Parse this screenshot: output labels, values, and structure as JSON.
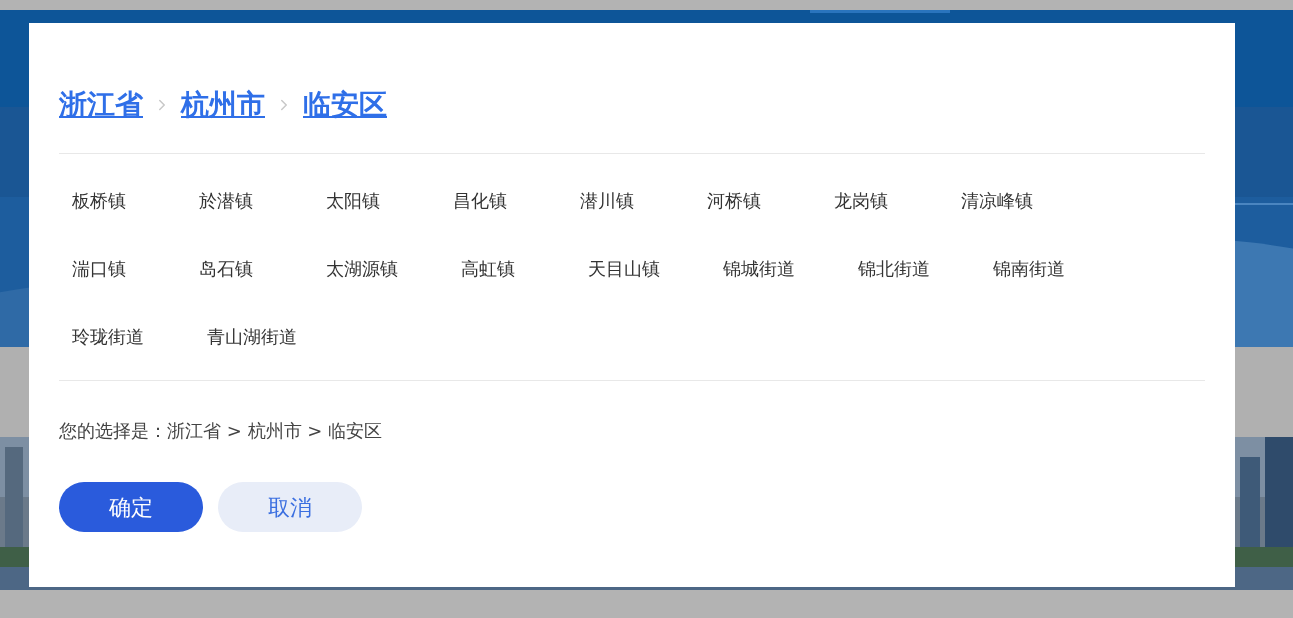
{
  "breadcrumb": [
    {
      "label": "浙江省"
    },
    {
      "label": "杭州市"
    },
    {
      "label": "临安区"
    }
  ],
  "towns": [
    {
      "label": "板桥镇",
      "selected": false
    },
    {
      "label": "於潜镇",
      "selected": false
    },
    {
      "label": "太阳镇",
      "selected": false
    },
    {
      "label": "昌化镇",
      "selected": false
    },
    {
      "label": "潜川镇",
      "selected": false
    },
    {
      "label": "河桥镇",
      "selected": false
    },
    {
      "label": "龙岗镇",
      "selected": false
    },
    {
      "label": "清凉峰镇",
      "selected": false
    },
    {
      "label": "湍口镇",
      "selected": false
    },
    {
      "label": "岛石镇",
      "selected": false
    },
    {
      "label": "太湖源镇",
      "selected": false
    },
    {
      "label": "高虹镇",
      "selected": false
    },
    {
      "label": "天目山镇",
      "selected": false
    },
    {
      "label": "锦城街道",
      "selected": false
    },
    {
      "label": "锦北街道",
      "selected": false
    },
    {
      "label": "锦南街道",
      "selected": false
    },
    {
      "label": "玲珑街道",
      "selected": false
    },
    {
      "label": "青山湖街道",
      "selected": false
    }
  ],
  "selection": {
    "label": "您的选择是：",
    "value": "浙江省 > 杭州市 > 临安区"
  },
  "buttons": [
    {
      "kind": "primary",
      "label": "确定"
    },
    {
      "kind": "secondary",
      "label": "取消"
    }
  ]
}
